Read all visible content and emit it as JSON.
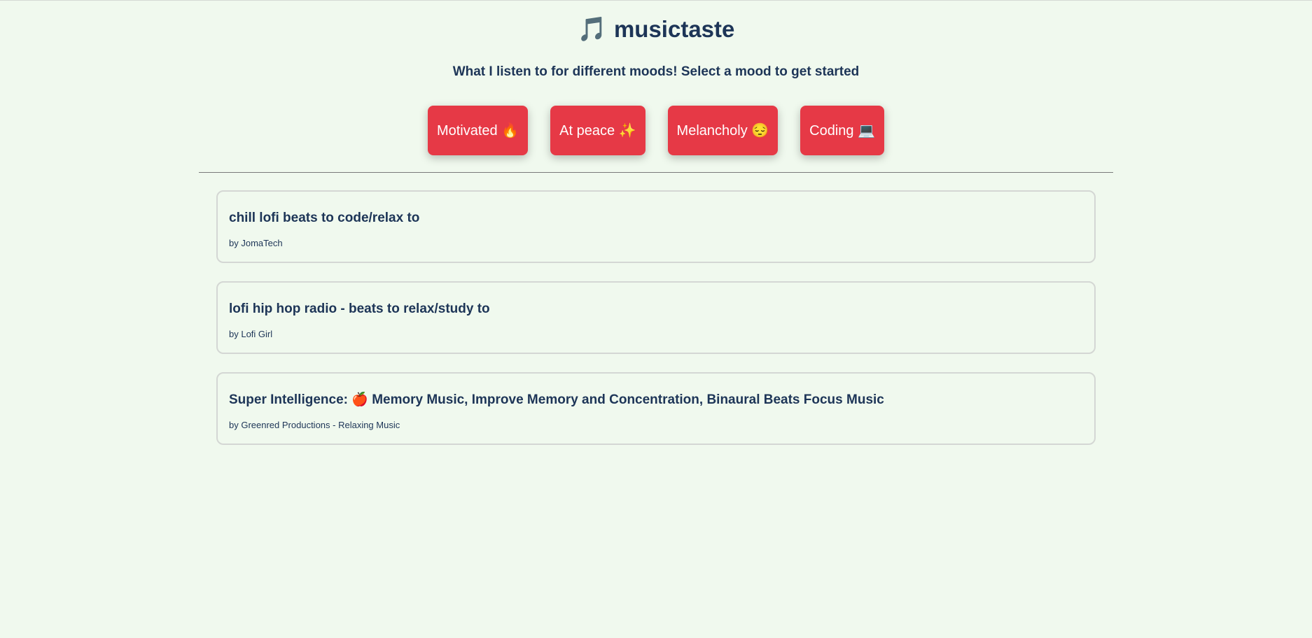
{
  "header": {
    "icon": "🎵",
    "title": "musictaste",
    "subtitle": "What I listen to for different moods! Select a mood to get started"
  },
  "moods": [
    {
      "label": "Motivated 🔥"
    },
    {
      "label": "At peace ✨"
    },
    {
      "label": "Melancholy 😔"
    },
    {
      "label": "Coding 💻"
    }
  ],
  "tracks": [
    {
      "title": "chill lofi beats to code/relax to",
      "author": "by JomaTech"
    },
    {
      "title": "lofi hip hop radio - beats to relax/study to",
      "author": "by Lofi Girl"
    },
    {
      "title": "Super Intelligence: 🍎 Memory Music, Improve Memory and Concentration, Binaural Beats Focus Music",
      "author": "by Greenred Productions - Relaxing Music"
    }
  ],
  "colors": {
    "background": "#f0f9ee",
    "text": "#1d3557",
    "button": "#e63946"
  }
}
